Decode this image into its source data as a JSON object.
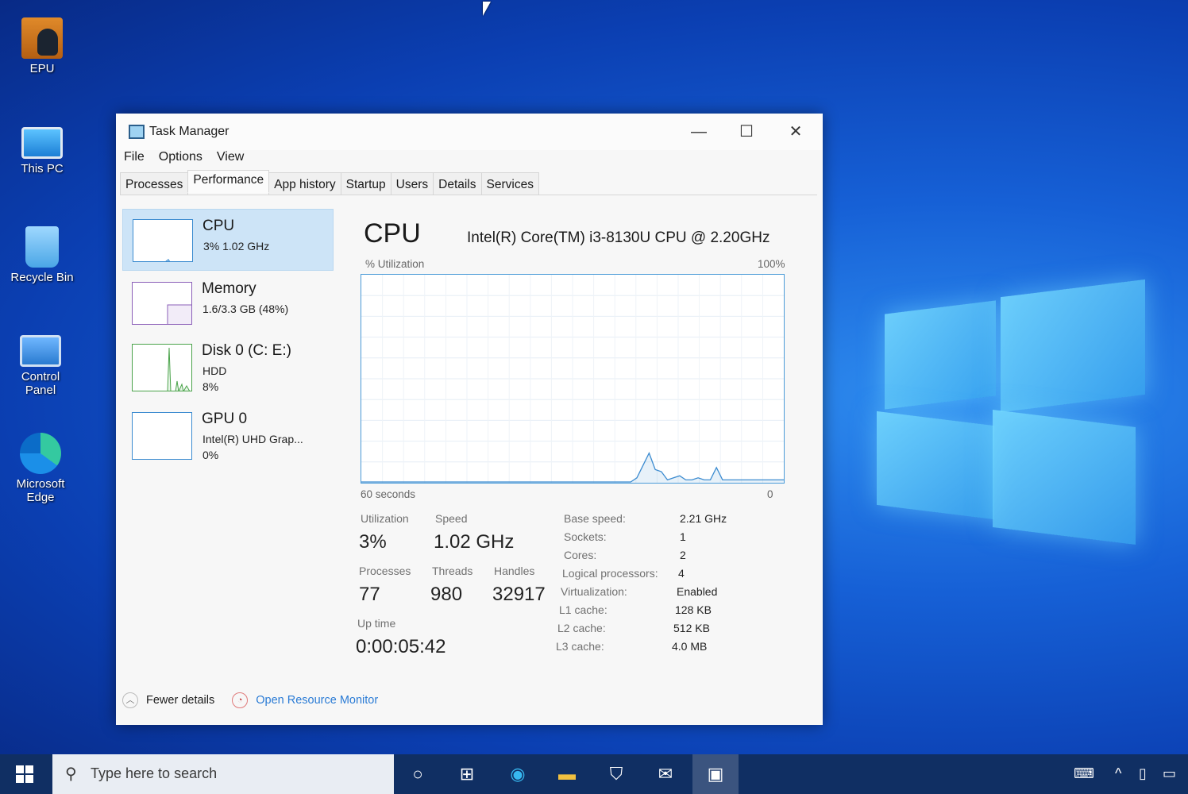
{
  "desktop": {
    "icons": [
      {
        "label": "EPU"
      },
      {
        "label": "This PC"
      },
      {
        "label": "Recycle Bin"
      },
      {
        "label": "Control Panel"
      },
      {
        "label": "Microsoft Edge"
      }
    ]
  },
  "window": {
    "title": "Task Manager",
    "controls": {
      "minimize": "—",
      "maximize": "☐",
      "close": "✕"
    },
    "menu": [
      "File",
      "Options",
      "View"
    ],
    "tabs": [
      "Processes",
      "Performance",
      "App history",
      "Startup",
      "Users",
      "Details",
      "Services"
    ],
    "active_tab": "Performance"
  },
  "sidebar": {
    "items": [
      {
        "name": "CPU",
        "line1": "3%  1.02 GHz",
        "line2": ""
      },
      {
        "name": "Memory",
        "line1": "1.6/3.3 GB (48%)",
        "line2": ""
      },
      {
        "name": "Disk 0 (C: E:)",
        "line1": "HDD",
        "line2": "8%"
      },
      {
        "name": "GPU 0",
        "line1": "Intel(R) UHD Grap...",
        "line2": "0%"
      }
    ]
  },
  "main": {
    "title": "CPU",
    "model": "Intel(R) Core(TM) i3-8130U CPU @ 2.20GHz",
    "graph_top_left": "% Utilization",
    "graph_top_right": "100%",
    "graph_bottom_left": "60 seconds",
    "graph_bottom_right": "0",
    "stats": {
      "utilization_label": "Utilization",
      "utilization": "3%",
      "speed_label": "Speed",
      "speed": "1.02 GHz",
      "processes_label": "Processes",
      "processes": "77",
      "threads_label": "Threads",
      "threads": "980",
      "handles_label": "Handles",
      "handles": "32917",
      "uptime_label": "Up time",
      "uptime": "0:00:05:42"
    },
    "specs": [
      {
        "k": "Base speed:",
        "v": "2.21 GHz"
      },
      {
        "k": "Sockets:",
        "v": "1"
      },
      {
        "k": "Cores:",
        "v": "2"
      },
      {
        "k": "Logical processors:",
        "v": "4"
      },
      {
        "k": "Virtualization:",
        "v": "Enabled"
      },
      {
        "k": "L1 cache:",
        "v": "128 KB"
      },
      {
        "k": "L2 cache:",
        "v": "512 KB"
      },
      {
        "k": "L3 cache:",
        "v": "4.0 MB"
      }
    ],
    "cpu_history_percent": [
      0,
      0,
      0,
      0,
      0,
      0,
      0,
      0,
      0,
      0,
      0,
      0,
      0,
      0,
      0,
      0,
      0,
      0,
      0,
      0,
      0,
      0,
      0,
      0,
      0,
      0,
      0,
      0,
      0,
      0,
      0,
      0,
      0,
      0,
      0,
      0,
      0,
      0,
      0,
      0,
      0,
      0,
      0,
      0,
      0,
      2,
      8,
      14,
      6,
      5,
      1,
      2,
      3,
      1,
      1,
      2,
      1,
      1,
      7,
      1,
      1,
      1,
      1,
      1,
      1,
      1,
      1,
      1,
      1,
      1
    ]
  },
  "footer": {
    "fewer": "Fewer details",
    "monitor": "Open Resource Monitor"
  },
  "taskbar": {
    "search_placeholder": "Type here to search"
  },
  "colors": {
    "accent": "#3b8bd0",
    "link": "#2a7bd5",
    "taskbar": "#102f63"
  }
}
